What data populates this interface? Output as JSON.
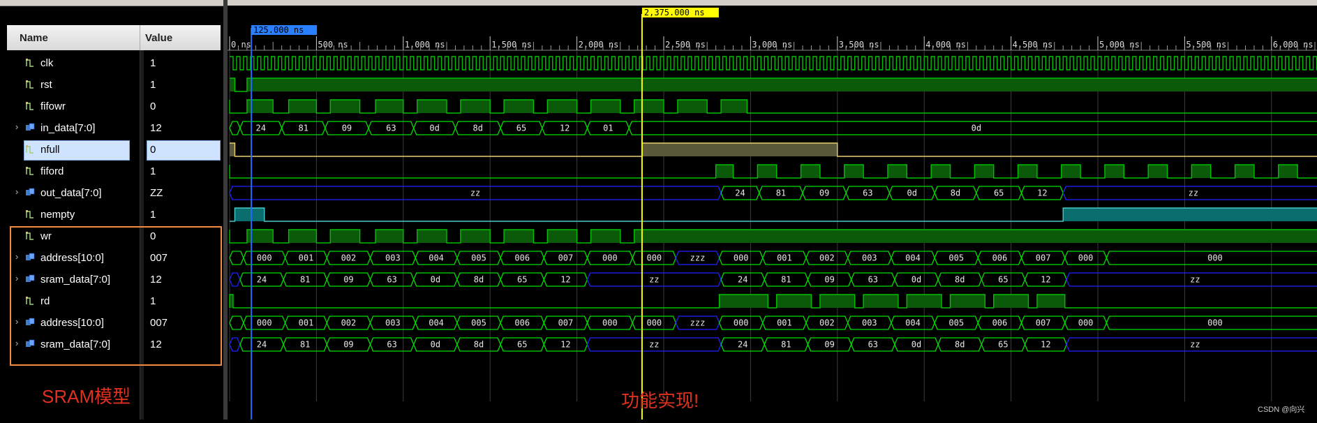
{
  "columns": {
    "name": "Name",
    "value": "Value"
  },
  "signals": [
    {
      "name": "clk",
      "value": "1",
      "type": "bit",
      "expandable": false
    },
    {
      "name": "rst",
      "value": "1",
      "type": "bit",
      "expandable": false
    },
    {
      "name": "fifowr",
      "value": "0",
      "type": "bit",
      "expandable": false
    },
    {
      "name": "in_data[7:0]",
      "value": "12",
      "type": "bus",
      "expandable": true
    },
    {
      "name": "nfull",
      "value": "0",
      "type": "bit",
      "expandable": false,
      "selected": true
    },
    {
      "name": "fiford",
      "value": "1",
      "type": "bit",
      "expandable": false
    },
    {
      "name": "out_data[7:0]",
      "value": "ZZ",
      "type": "bus",
      "expandable": true
    },
    {
      "name": "nempty",
      "value": "1",
      "type": "bit",
      "expandable": false
    },
    {
      "name": "wr",
      "value": "0",
      "type": "bit",
      "expandable": false
    },
    {
      "name": "address[10:0]",
      "value": "007",
      "type": "bus",
      "expandable": true
    },
    {
      "name": "sram_data[7:0]",
      "value": "12",
      "type": "bus",
      "expandable": true
    },
    {
      "name": "rd",
      "value": "1",
      "type": "bit",
      "expandable": false
    },
    {
      "name": "address[10:0]",
      "value": "007",
      "type": "bus",
      "expandable": true
    },
    {
      "name": "sram_data[7:0]",
      "value": "12",
      "type": "bus",
      "expandable": true
    }
  ],
  "timeline": {
    "ticks": [
      "0 ns",
      "500 ns",
      "1,000 ns",
      "1,500 ns",
      "2,000 ns",
      "2,500 ns",
      "3,000 ns",
      "3,500 ns",
      "4,000 ns",
      "4,500 ns",
      "5,000 ns",
      "5,500 ns",
      "6,000 ns"
    ],
    "cursor_main": "2,375.000 ns",
    "cursor_blue": "125.000 ns"
  },
  "bus_labels": {
    "in_data": [
      "24",
      "81",
      "09",
      "63",
      "0d",
      "8d",
      "65",
      "12",
      "01",
      "0d"
    ],
    "out_data": [
      "ZZ",
      "24",
      "81",
      "09",
      "63",
      "0d",
      "8d",
      "65",
      "12",
      "ZZ"
    ],
    "address": [
      "000",
      "001",
      "002",
      "003",
      "004",
      "005",
      "006",
      "007",
      "000",
      "000",
      "ZZZ",
      "000",
      "001",
      "002",
      "003",
      "004",
      "005",
      "006",
      "007",
      "000",
      "000"
    ],
    "sram_data": [
      "24",
      "81",
      "09",
      "63",
      "0d",
      "8d",
      "65",
      "12",
      "ZZ",
      "24",
      "81",
      "09",
      "63",
      "0d",
      "8d",
      "65",
      "12",
      "ZZ"
    ]
  },
  "annotations": {
    "sram_model": "SRAM模型",
    "function_ok": "功能实现!",
    "credit": "CSDN @向兴"
  },
  "colors": {
    "wave": "#00c000",
    "bus": "#00e000",
    "highz": "#2020ff",
    "cursor": "#ffff00",
    "nfull_fill": "#5a5a3a",
    "nempty_fill": "#0b6e6e",
    "annot": "#e03020"
  }
}
